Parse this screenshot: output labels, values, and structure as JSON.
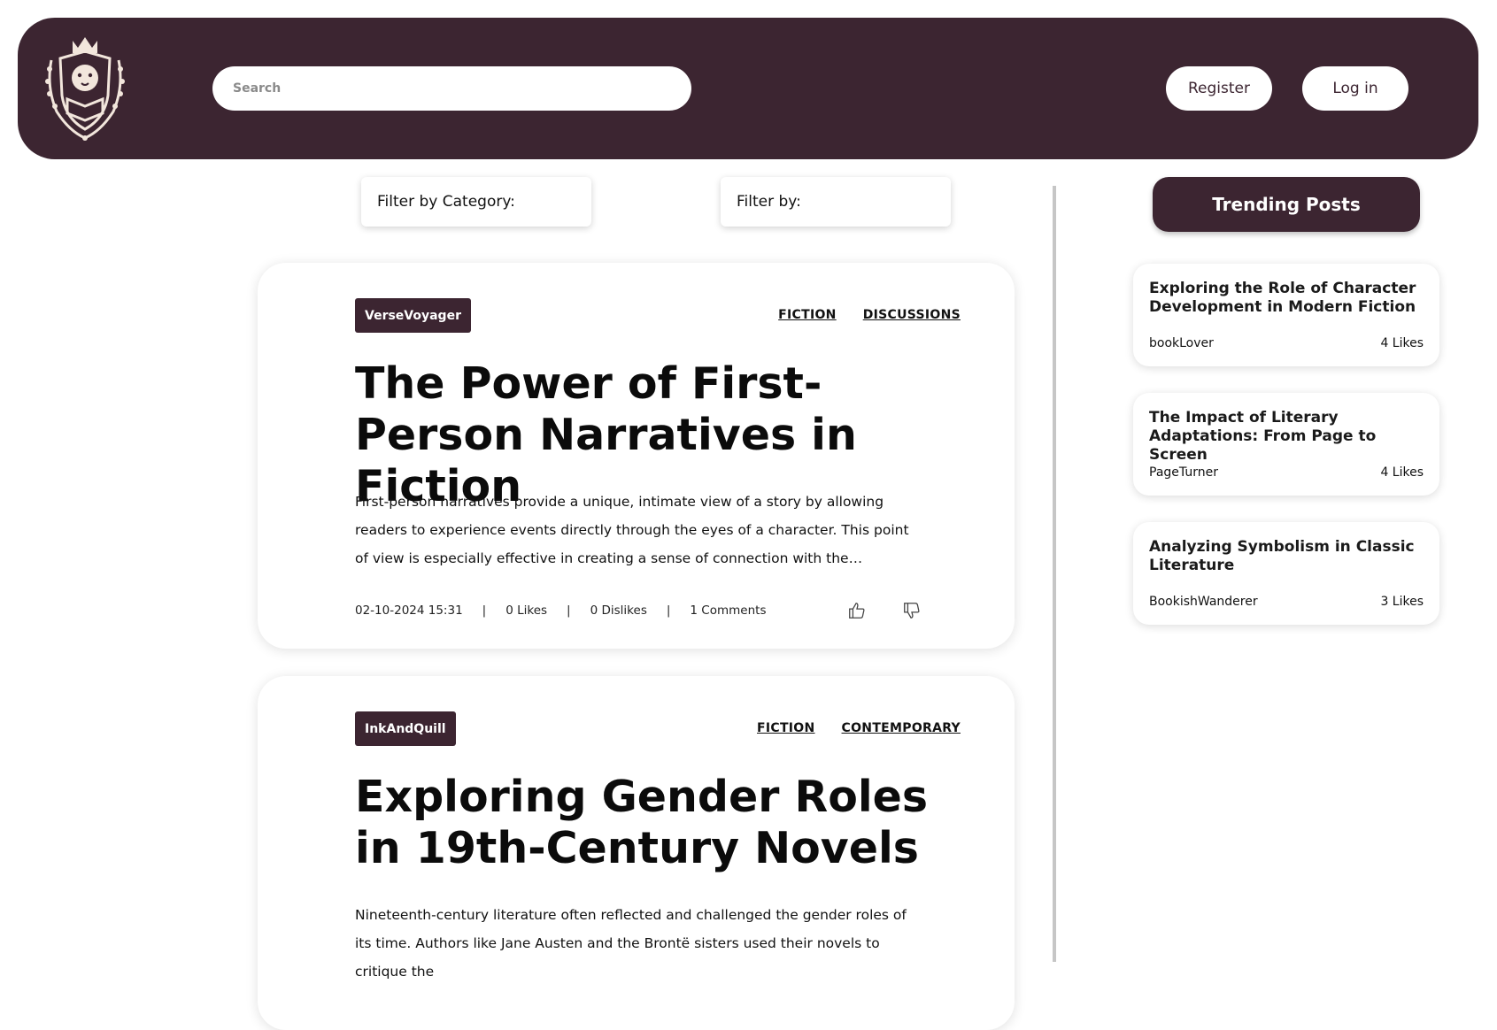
{
  "header": {
    "search_placeholder": "Search",
    "register_label": "Register",
    "login_label": "Log in"
  },
  "filters": {
    "category_label": "Filter by Category:",
    "by_label": "Filter by:"
  },
  "posts": [
    {
      "author": "VerseVoyager",
      "categories": [
        "FICTION",
        "DISCUSSIONS"
      ],
      "title": "The Power of First-Person Narratives in Fiction",
      "excerpt": "First-person narratives provide a unique, intimate view of a story by allowing readers to experience events directly through the eyes of a character. This point of view is especially effective in creating a sense of connection with the protagonist, as readers…",
      "date": "02-10-2024 15:31",
      "likes": "0 Likes",
      "dislikes": "0 Dislikes",
      "comments": "1 Comments"
    },
    {
      "author": "InkAndQuill",
      "categories": [
        "FICTION",
        "CONTEMPORARY"
      ],
      "title": "Exploring Gender Roles in 19th-Century Novels",
      "excerpt": "Nineteenth-century literature often reflected and challenged the gender roles of its time. Authors like Jane Austen and the Brontë sisters used their novels to critique the"
    }
  ],
  "trending": {
    "heading": "Trending Posts",
    "items": [
      {
        "title": "Exploring the Role of Character Development in Modern Fiction",
        "author": "bookLover",
        "likes": "4 Likes"
      },
      {
        "title": "The Impact of Literary Adaptations: From Page to Screen",
        "author": "PageTurner",
        "likes": "4 Likes"
      },
      {
        "title": "Analyzing Symbolism in Classic Literature",
        "author": "BookishWanderer",
        "likes": "3 Likes"
      }
    ]
  },
  "icons": {
    "logo": "lion-crest-logo",
    "like": "thumbs-up-icon",
    "dislike": "thumbs-down-icon"
  },
  "colors": {
    "brand": "#3c2531",
    "logo_cream": "#f2e6dc"
  }
}
